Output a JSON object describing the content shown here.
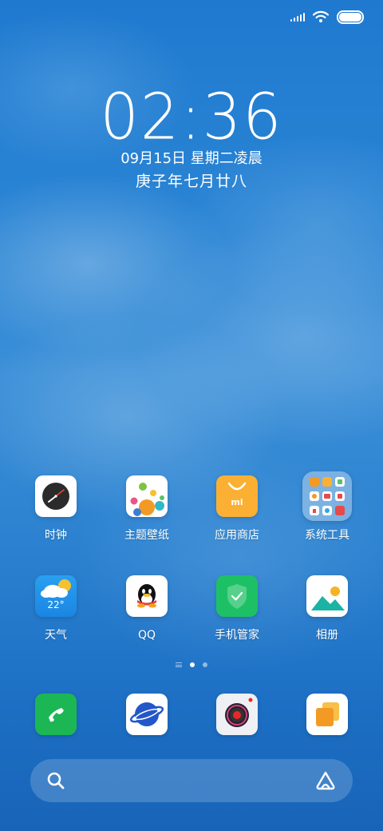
{
  "status_bar": {
    "signal_icon": "signal-bars-icon",
    "wifi_icon": "wifi-icon",
    "battery_icon": "battery-icon",
    "battery_level": 1.0
  },
  "lockscreen": {
    "time": "02:36",
    "date": "09月15日 星期二凌晨",
    "lunar": "庚子年七月廿八"
  },
  "apps": [
    {
      "label": "时钟",
      "icon": "clock-icon"
    },
    {
      "label": "主题壁纸",
      "icon": "themes-icon"
    },
    {
      "label": "应用商店",
      "icon": "app-store-icon"
    },
    {
      "label": "系统工具",
      "icon": "folder-icon"
    },
    {
      "label": "天气",
      "icon": "weather-icon",
      "temp": "22°"
    },
    {
      "label": "QQ",
      "icon": "qq-icon"
    },
    {
      "label": "手机管家",
      "icon": "security-icon"
    },
    {
      "label": "相册",
      "icon": "gallery-icon"
    }
  ],
  "dock": [
    {
      "icon": "phone-icon"
    },
    {
      "icon": "browser-icon"
    },
    {
      "icon": "camera-icon"
    },
    {
      "icon": "multitask-icon"
    }
  ],
  "search_bar": {
    "search_icon": "search-icon",
    "assistant_icon": "assistant-icon"
  },
  "colors": {
    "store_orange": "#fbb033",
    "security_green": "#1ec065",
    "phone_green": "#1cb754",
    "browser_blue": "#2356c9"
  }
}
